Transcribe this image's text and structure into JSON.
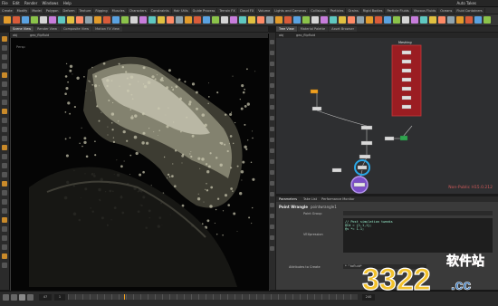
{
  "menubar": {
    "items": [
      "File",
      "Edit",
      "Render",
      "Windows",
      "Help"
    ],
    "desktop_label": "Auto Takes"
  },
  "shelf_tabs": [
    "Create",
    "Modify",
    "Model",
    "Polygon",
    "Deform",
    "Texture",
    "Rigging",
    "Muscles",
    "Characters",
    "Constraints",
    "Hair Utils",
    "Guide Process",
    "Terrain FX",
    "Cloud FX",
    "Volume",
    "Lights and Cameras",
    "Collisions",
    "Particles",
    "Grains",
    "Rigid Bodies",
    "Particle Fluids",
    "Viscous Fluids",
    "Oceans",
    "Fluid Containers",
    "Populate Containers",
    "Container Tools",
    "Pyro FX",
    "Cloth",
    "Solid",
    "Wires",
    "Crowds",
    "Drive Simulation"
  ],
  "left_tabs": [
    "Scene View",
    "Render View",
    "Composite View",
    "Motion FX View"
  ],
  "right_tabs": [
    "Tree View",
    "Material Palette",
    "Asset Browser"
  ],
  "viewport": {
    "path_label": "obj",
    "title_label": "geo_flipfluid",
    "corner_label": "Persp",
    "cam_label": "persp1"
  },
  "network": {
    "path_label": "obj",
    "node_name": "geo_flipfluid",
    "red_box_title": "Meshing",
    "watermark": "Non-Public H15.0.212",
    "nodes": [
      "flip_source",
      "flipsolver",
      "fluidcompress",
      "surface",
      "dopimport",
      "particlefluidsurface",
      "convert",
      "null1",
      "OUT"
    ]
  },
  "params": {
    "tabs": [
      "Parameters",
      "Take List",
      "Performance Monitor"
    ],
    "node_type": "Point Wrangle",
    "node_name": "pointwrangle1",
    "group_label": "Point Group",
    "vex_label": "VEXpression",
    "attrib_label": "Attributes to Create",
    "attrib_value": "* ^tofluid*",
    "code_lines": [
      "// Post simulation tweaks",
      "@Cd = {1,1,1};",
      "@v *= 1.1;"
    ]
  },
  "timeline": {
    "start_frame": "1",
    "current_frame": "47",
    "end_frame": "240",
    "fps_label": "24"
  },
  "logo": {
    "number": "3322",
    "cn_text": "软件站",
    "domain": ".cc"
  },
  "colors": {
    "accent_orange": "#f0a020",
    "node_red": "#9b1d22",
    "blue_ring": "#2aa7e6",
    "purple_ring": "#8a5fd0",
    "green_node": "#2fa44f",
    "logo_red": "#e8452c",
    "logo_yellow": "#f2c12b",
    "logo_blue": "#2d6fb6"
  }
}
